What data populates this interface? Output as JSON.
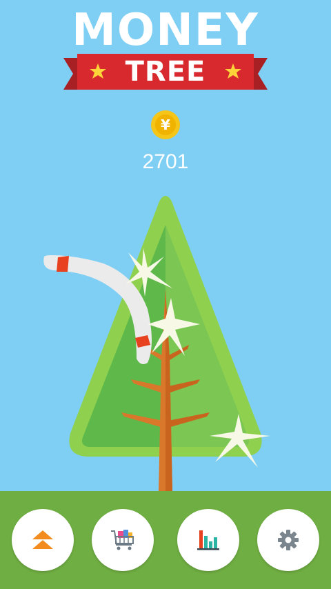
{
  "title": {
    "line1": "MONEY",
    "line2": "TREE"
  },
  "coin": {
    "icon": "yen-coin-icon",
    "symbol": "¥"
  },
  "score": "2701",
  "colors": {
    "sky": "#7fcff5",
    "ground": "#6fae43",
    "ribbon": "#d8292e",
    "tree_light": "#8fd14f",
    "trunk": "#d9772a",
    "coin": "#f5c518",
    "button_accent": "#f28c1e"
  },
  "toolbar": {
    "buttons": [
      {
        "name": "upgrade-button",
        "icon": "double-chevron-up-icon"
      },
      {
        "name": "shop-button",
        "icon": "shopping-cart-icon"
      },
      {
        "name": "stats-button",
        "icon": "bar-chart-icon"
      },
      {
        "name": "settings-button",
        "icon": "gear-icon"
      }
    ]
  }
}
